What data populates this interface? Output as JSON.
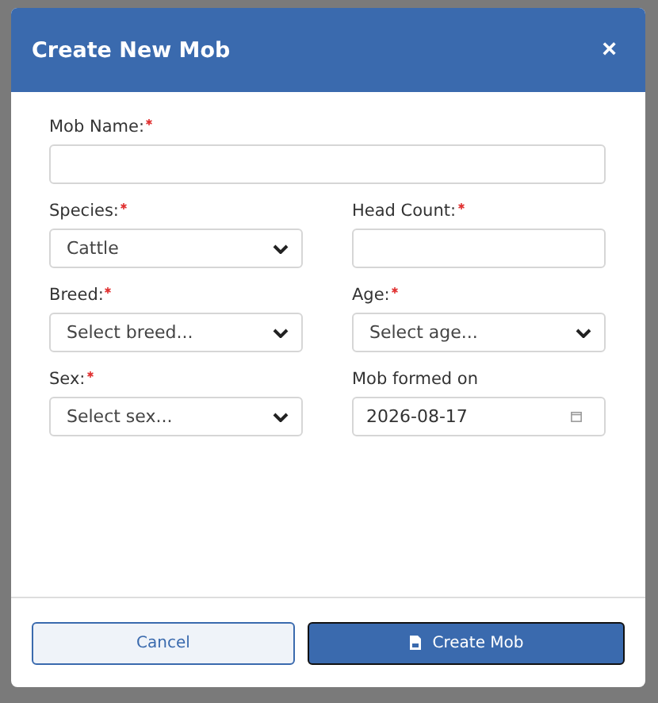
{
  "dialog": {
    "title": "Create New Mob",
    "close": "×"
  },
  "fields": [
    {
      "kind": "text",
      "label": "Mob Name:",
      "required": true,
      "full": true
    },
    {
      "kind": "select",
      "label": "Species:",
      "required": true,
      "value": "Cattle"
    },
    {
      "kind": "text",
      "label": "Head Count:",
      "required": true
    },
    {
      "kind": "select",
      "label": "Breed:",
      "required": true,
      "value": "Select breed..."
    },
    {
      "kind": "select",
      "label": "Age:",
      "required": true,
      "value": "Select age..."
    },
    {
      "kind": "select",
      "label": "Sex:",
      "required": true,
      "value": "Select sex..."
    },
    {
      "kind": "date",
      "label": "Mob formed on",
      "required": false,
      "value": "2026-08-17"
    }
  ],
  "buttons": [
    {
      "kind": "secondary",
      "label": "Cancel"
    },
    {
      "kind": "primary",
      "label": "Create Mob"
    }
  ]
}
